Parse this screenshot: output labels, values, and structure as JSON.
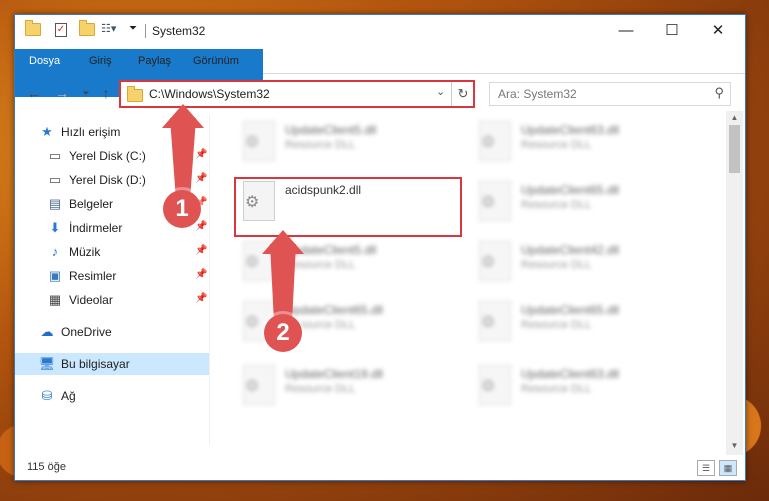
{
  "window": {
    "title": "System32"
  },
  "ribbon": {
    "tabs": [
      "Dosya",
      "Giriş",
      "Paylaş",
      "Görünüm"
    ]
  },
  "address": {
    "path": "C:\\Windows\\System32"
  },
  "search": {
    "placeholder": "Ara: System32"
  },
  "sidebar": {
    "items": [
      {
        "label": "Hızlı erişim",
        "icon": "star-icon",
        "pinned": false
      },
      {
        "label": "Yerel Disk (C:)",
        "icon": "drive-icon",
        "pinned": true
      },
      {
        "label": "Yerel Disk (D:)",
        "icon": "drive-icon",
        "pinned": true
      },
      {
        "label": "Belgeler",
        "icon": "document-icon",
        "pinned": true
      },
      {
        "label": "İndirmeler",
        "icon": "download-icon",
        "pinned": true
      },
      {
        "label": "Müzik",
        "icon": "music-icon",
        "pinned": true
      },
      {
        "label": "Resimler",
        "icon": "image-icon",
        "pinned": true
      },
      {
        "label": "Videolar",
        "icon": "video-icon",
        "pinned": true
      },
      {
        "label": "OneDrive",
        "icon": "cloud-icon",
        "pinned": false
      },
      {
        "label": "Bu bilgisayar",
        "icon": "computer-icon",
        "pinned": false,
        "selected": true
      },
      {
        "label": "Ağ",
        "icon": "network-icon",
        "pinned": false
      }
    ]
  },
  "files": [
    {
      "name": "UpdateClient5.dll",
      "desc": "Resource DLL",
      "blurred": true
    },
    {
      "name": "UpdateClient63.dll",
      "desc": "Resource DLL",
      "blurred": true
    },
    {
      "name": "acidspunk2.dll",
      "desc": "",
      "blurred": false,
      "highlighted": true
    },
    {
      "name": "UpdateClient65.dll",
      "desc": "Resource DLL",
      "blurred": true
    },
    {
      "name": "UpdateClient5.dll",
      "desc": "Resource DLL",
      "blurred": true
    },
    {
      "name": "UpdateClient42.dll",
      "desc": "Resource DLL",
      "blurred": true
    },
    {
      "name": "UpdateClient65.dll",
      "desc": "Resource DLL",
      "blurred": true
    },
    {
      "name": "UpdateClient65.dll",
      "desc": "Resource DLL",
      "blurred": true
    },
    {
      "name": "UpdateClient19.dll",
      "desc": "Resource DLL",
      "blurred": true
    },
    {
      "name": "UpdateClient63.dll",
      "desc": "Resource DLL",
      "blurred": true
    }
  ],
  "status": {
    "count": "115 öğe"
  },
  "annotations": {
    "badge1": "1",
    "badge2": "2",
    "color": "#e05353"
  },
  "colors": {
    "accent": "#1979ca",
    "highlight_border": "#d9363e",
    "selected_bg": "#cce8ff"
  }
}
